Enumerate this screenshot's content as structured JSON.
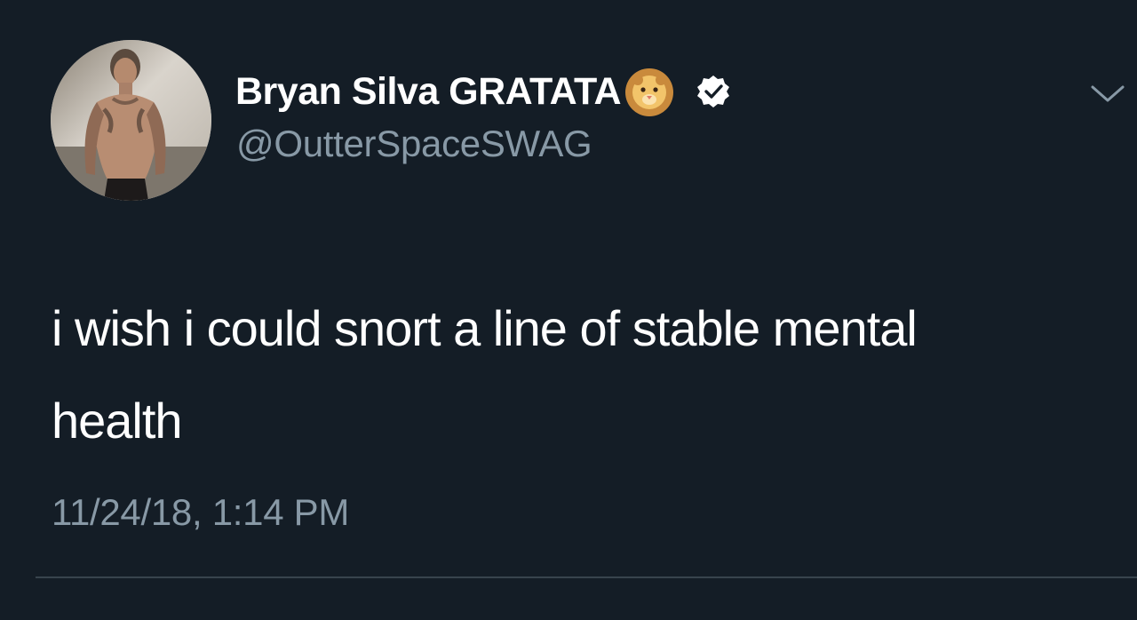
{
  "tweet": {
    "display_name": "Bryan Silva GRATATA",
    "name_emoji": "lion-face-icon",
    "verified": true,
    "handle": "@OutterSpaceSWAG",
    "text": "i wish i could snort a line of stable mental health",
    "timestamp": "11/24/18, 1:14 PM"
  },
  "icons": {
    "more": "chevron-down-icon",
    "verified": "verified-badge-icon",
    "avatar": "avatar"
  },
  "colors": {
    "background": "#141d26",
    "primary_text": "#ffffff",
    "secondary_text": "#8899a6",
    "divider": "#38444d"
  }
}
